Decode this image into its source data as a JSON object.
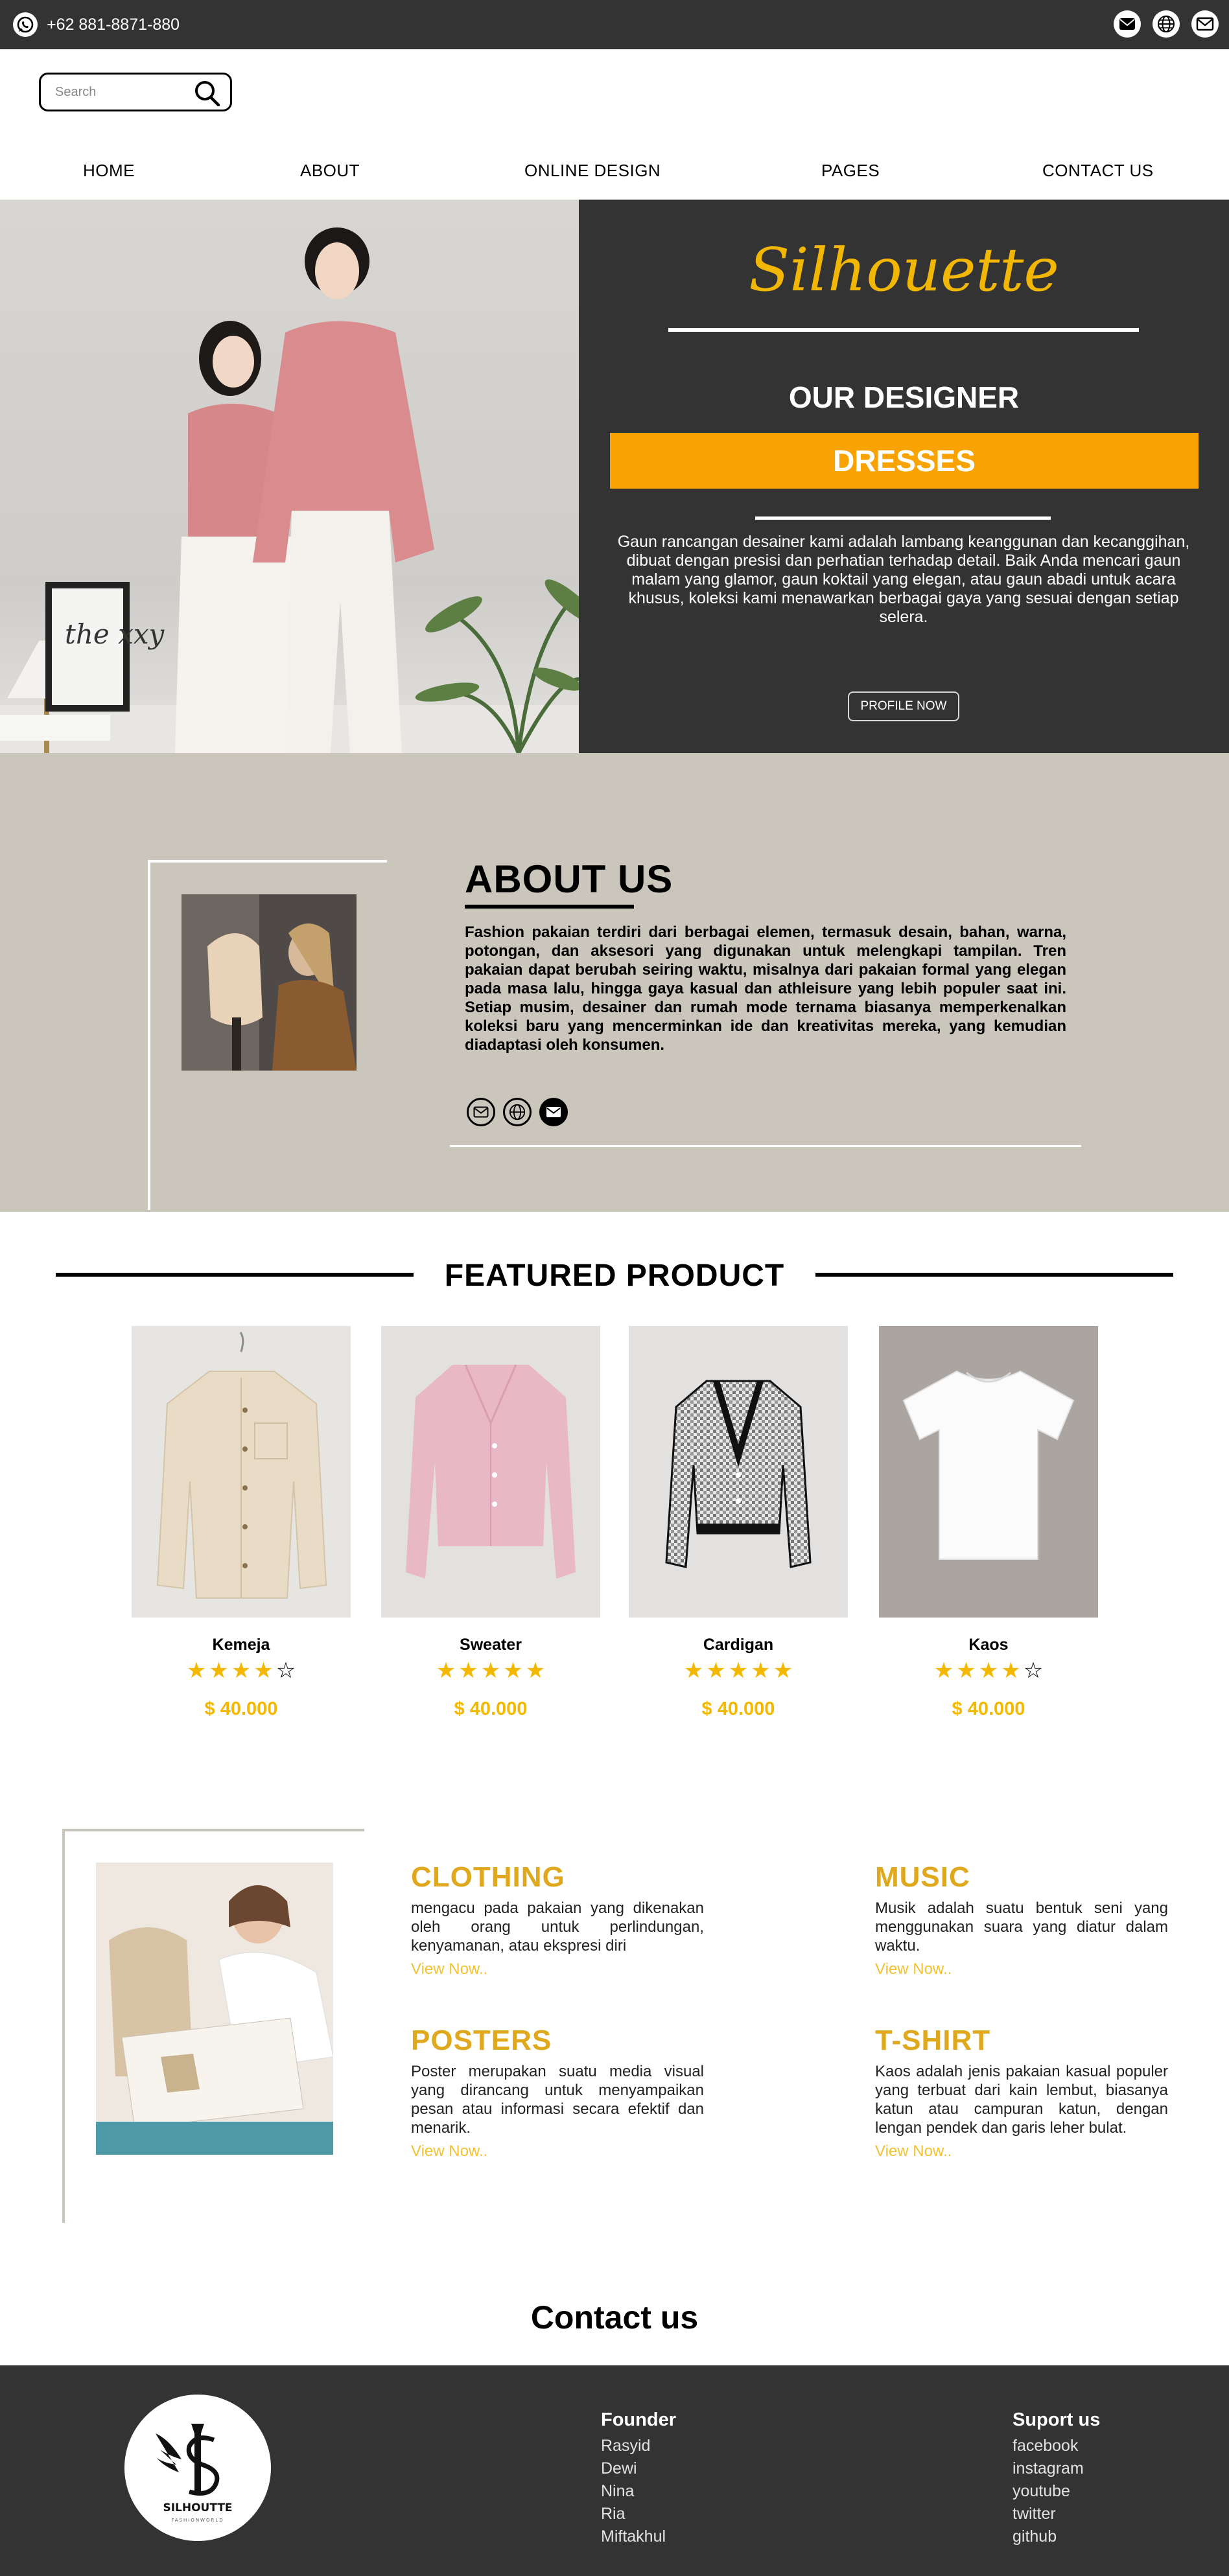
{
  "topbar": {
    "phone": "+62 881-8871-880",
    "icons": [
      "whatsapp-icon",
      "email-icon",
      "globe-icon",
      "mail-outline-icon"
    ]
  },
  "search": {
    "placeholder": "Search"
  },
  "nav": {
    "items": [
      "HOME",
      "ABOUT",
      "ONLINE DESIGN",
      "PAGES",
      "CONTACT US"
    ]
  },
  "hero": {
    "script_title": "Silhouette",
    "subtitle": "OUR DESIGNER",
    "highlight": "DRESSES",
    "description": "Gaun rancangan desainer kami adalah lambang keanggunan dan kecanggihan, dibuat dengan presisi dan perhatian terhadap detail. Baik Anda mencari gaun malam yang glamor, gaun koktail yang elegan, atau gaun abadi untuk acara khusus, koleksi kami menawarkan berbagai gaya yang sesuai dengan setiap selera.",
    "button": "PROFILE NOW",
    "art_text": "the xxy"
  },
  "about": {
    "title": "ABOUT US",
    "text": "Fashion pakaian terdiri dari berbagai elemen, termasuk desain, bahan, warna, potongan, dan aksesori yang digunakan untuk melengkapi tampilan. Tren pakaian dapat berubah seiring waktu, misalnya dari pakaian formal yang elegan pada masa lalu, hingga gaya kasual dan athleisure yang lebih populer saat ini. Setiap musim, desainer dan rumah mode ternama biasanya memperkenalkan koleksi baru yang mencerminkan ide dan kreativitas mereka, yang kemudian diadaptasi oleh konsumen.",
    "icons": [
      "mail-outline-icon",
      "globe-icon",
      "email-icon"
    ]
  },
  "featured": {
    "title": "FEATURED PRODUCT",
    "products": [
      {
        "name": "Kemeja",
        "rating": 4,
        "price": "$ 40.000"
      },
      {
        "name": "Sweater",
        "rating": 5,
        "price": "$ 40.000"
      },
      {
        "name": "Cardigan",
        "rating": 5,
        "price": "$ 40.000"
      },
      {
        "name": "Kaos",
        "rating": 4,
        "price": "$ 40.000"
      }
    ]
  },
  "categories": [
    {
      "title": "CLOTHING",
      "text": "mengacu pada pakaian yang dikenakan oleh orang untuk perlindungan, kenyamanan, atau ekspresi diri",
      "link": "View Now.."
    },
    {
      "title": "MUSIC",
      "text": "Musik adalah suatu bentuk seni yang menggunakan suara yang diatur dalam waktu.",
      "link": "View Now.."
    },
    {
      "title": "POSTERS",
      "text": "Poster merupakan suatu media visual yang dirancang untuk menyampaikan pesan atau informasi secara efektif dan menarik.",
      "link": "View Now.."
    },
    {
      "title": "T-SHIRT",
      "text": "Kaos adalah jenis pakaian kasual populer yang terbuat dari kain lembut, biasanya katun atau campuran katun, dengan lengan pendek dan garis leher bulat.",
      "link": "View Now.."
    }
  ],
  "contact": {
    "title": "Contact us"
  },
  "footer": {
    "logo_text": "SILHOUTTE",
    "logo_sub": "FASHIONWORLD",
    "founder": {
      "heading": "Founder",
      "items": [
        "Rasyid",
        "Dewi",
        "Nina",
        "Ria",
        "Miftakhul"
      ]
    },
    "support": {
      "heading": "Suport us",
      "items": [
        "facebook",
        "instagram",
        "youtube",
        "twitter",
        "github"
      ]
    }
  },
  "colors": {
    "dark": "#333333",
    "accent": "#f9a302",
    "gold": "#e0a81c",
    "star": "#f5b800",
    "beige": "#cac6bb"
  }
}
